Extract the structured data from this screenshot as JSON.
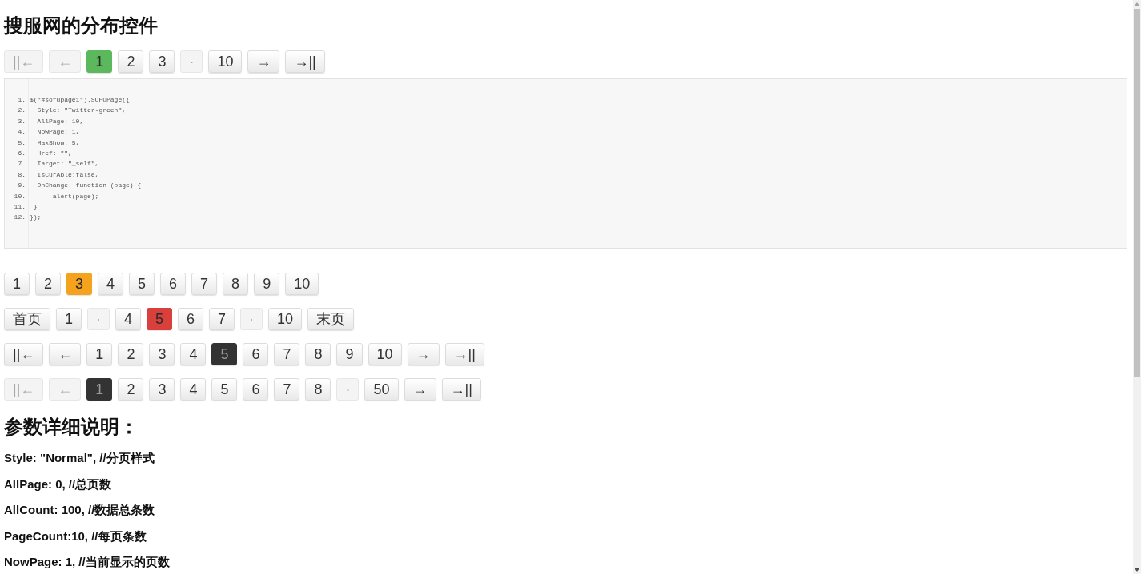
{
  "page_title": "搜服网的分布控件",
  "first_pager": {
    "color": "#5cb85c",
    "buttons": [
      {
        "label": "||←",
        "selected": false,
        "disabled": true
      },
      {
        "label": "←",
        "selected": false,
        "disabled": true
      },
      {
        "label": "1",
        "selected": true,
        "disabled": false
      },
      {
        "label": "2",
        "selected": false,
        "disabled": false
      },
      {
        "label": "3",
        "selected": false,
        "disabled": false
      },
      {
        "label": "·",
        "selected": false,
        "disabled": true
      },
      {
        "label": "10",
        "selected": false,
        "disabled": false
      },
      {
        "label": "→",
        "selected": false,
        "disabled": false
      },
      {
        "label": "→||",
        "selected": false,
        "disabled": false
      }
    ]
  },
  "code_block": {
    "lines": [
      {
        "number": "1.",
        "text": "$(\"#sofupage1\").SOFUPage({"
      },
      {
        "number": "2.",
        "text": "  Style: \"Twitter-green\","
      },
      {
        "number": "3.",
        "text": "  AllPage: 10,"
      },
      {
        "number": "4.",
        "text": "  NowPage: 1,"
      },
      {
        "number": "5.",
        "text": "  MaxShow: 5,"
      },
      {
        "number": "6.",
        "text": "  Href: \"\","
      },
      {
        "number": "7.",
        "text": "  Target: \"_self\","
      },
      {
        "number": "8.",
        "text": "  IsCurAble:false,"
      },
      {
        "number": "9.",
        "text": "  OnChange: function (page) {"
      },
      {
        "number": "10.",
        "text": "      alert(page);"
      },
      {
        "number": "11.",
        "text": " }"
      },
      {
        "number": "12.",
        "text": "});"
      }
    ]
  },
  "pagers": [
    {
      "color": "#f5a21c",
      "buttons": [
        {
          "label": "1",
          "selected": false,
          "disabled": false
        },
        {
          "label": "2",
          "selected": false,
          "disabled": false
        },
        {
          "label": "3",
          "selected": true,
          "disabled": false
        },
        {
          "label": "4",
          "selected": false,
          "disabled": false
        },
        {
          "label": "5",
          "selected": false,
          "disabled": false
        },
        {
          "label": "6",
          "selected": false,
          "disabled": false
        },
        {
          "label": "7",
          "selected": false,
          "disabled": false
        },
        {
          "label": "8",
          "selected": false,
          "disabled": false
        },
        {
          "label": "9",
          "selected": false,
          "disabled": false
        },
        {
          "label": "10",
          "selected": false,
          "disabled": false
        }
      ]
    },
    {
      "color": "#d9403c",
      "buttons": [
        {
          "label": "首页",
          "selected": false,
          "disabled": false
        },
        {
          "label": "1",
          "selected": false,
          "disabled": false
        },
        {
          "label": "·",
          "selected": false,
          "disabled": true
        },
        {
          "label": "4",
          "selected": false,
          "disabled": false
        },
        {
          "label": "5",
          "selected": true,
          "disabled": false
        },
        {
          "label": "6",
          "selected": false,
          "disabled": false
        },
        {
          "label": "7",
          "selected": false,
          "disabled": false
        },
        {
          "label": "·",
          "selected": false,
          "disabled": true
        },
        {
          "label": "10",
          "selected": false,
          "disabled": false
        },
        {
          "label": "末页",
          "selected": false,
          "disabled": false
        }
      ]
    },
    {
      "color": "#333333",
      "buttons": [
        {
          "label": "||←",
          "selected": false,
          "disabled": false
        },
        {
          "label": "←",
          "selected": false,
          "disabled": false
        },
        {
          "label": "1",
          "selected": false,
          "disabled": false
        },
        {
          "label": "2",
          "selected": false,
          "disabled": false
        },
        {
          "label": "3",
          "selected": false,
          "disabled": false
        },
        {
          "label": "4",
          "selected": false,
          "disabled": false
        },
        {
          "label": "5",
          "selected": true,
          "disabled": false
        },
        {
          "label": "6",
          "selected": false,
          "disabled": false
        },
        {
          "label": "7",
          "selected": false,
          "disabled": false
        },
        {
          "label": "8",
          "selected": false,
          "disabled": false
        },
        {
          "label": "9",
          "selected": false,
          "disabled": false
        },
        {
          "label": "10",
          "selected": false,
          "disabled": false
        },
        {
          "label": "→",
          "selected": false,
          "disabled": false
        },
        {
          "label": "→||",
          "selected": false,
          "disabled": false
        }
      ]
    },
    {
      "color": "#333333",
      "buttons": [
        {
          "label": "||←",
          "selected": false,
          "disabled": true
        },
        {
          "label": "←",
          "selected": false,
          "disabled": true
        },
        {
          "label": "1",
          "selected": true,
          "disabled": false
        },
        {
          "label": "2",
          "selected": false,
          "disabled": false
        },
        {
          "label": "3",
          "selected": false,
          "disabled": false
        },
        {
          "label": "4",
          "selected": false,
          "disabled": false
        },
        {
          "label": "5",
          "selected": false,
          "disabled": false
        },
        {
          "label": "6",
          "selected": false,
          "disabled": false
        },
        {
          "label": "7",
          "selected": false,
          "disabled": false
        },
        {
          "label": "8",
          "selected": false,
          "disabled": false
        },
        {
          "label": "·",
          "selected": false,
          "disabled": true
        },
        {
          "label": "50",
          "selected": false,
          "disabled": false
        },
        {
          "label": "→",
          "selected": false,
          "disabled": false
        },
        {
          "label": "→||",
          "selected": false,
          "disabled": false
        }
      ]
    }
  ],
  "section_heading": "参数详细说明：",
  "parameters": [
    "Style: \"Normal\", //分页样式",
    "AllPage: 0, //总页数",
    "AllCount: 100, //数据总条数",
    "PageCount:10, //每页条数",
    "NowPage: 1, //当前显示的页数"
  ]
}
